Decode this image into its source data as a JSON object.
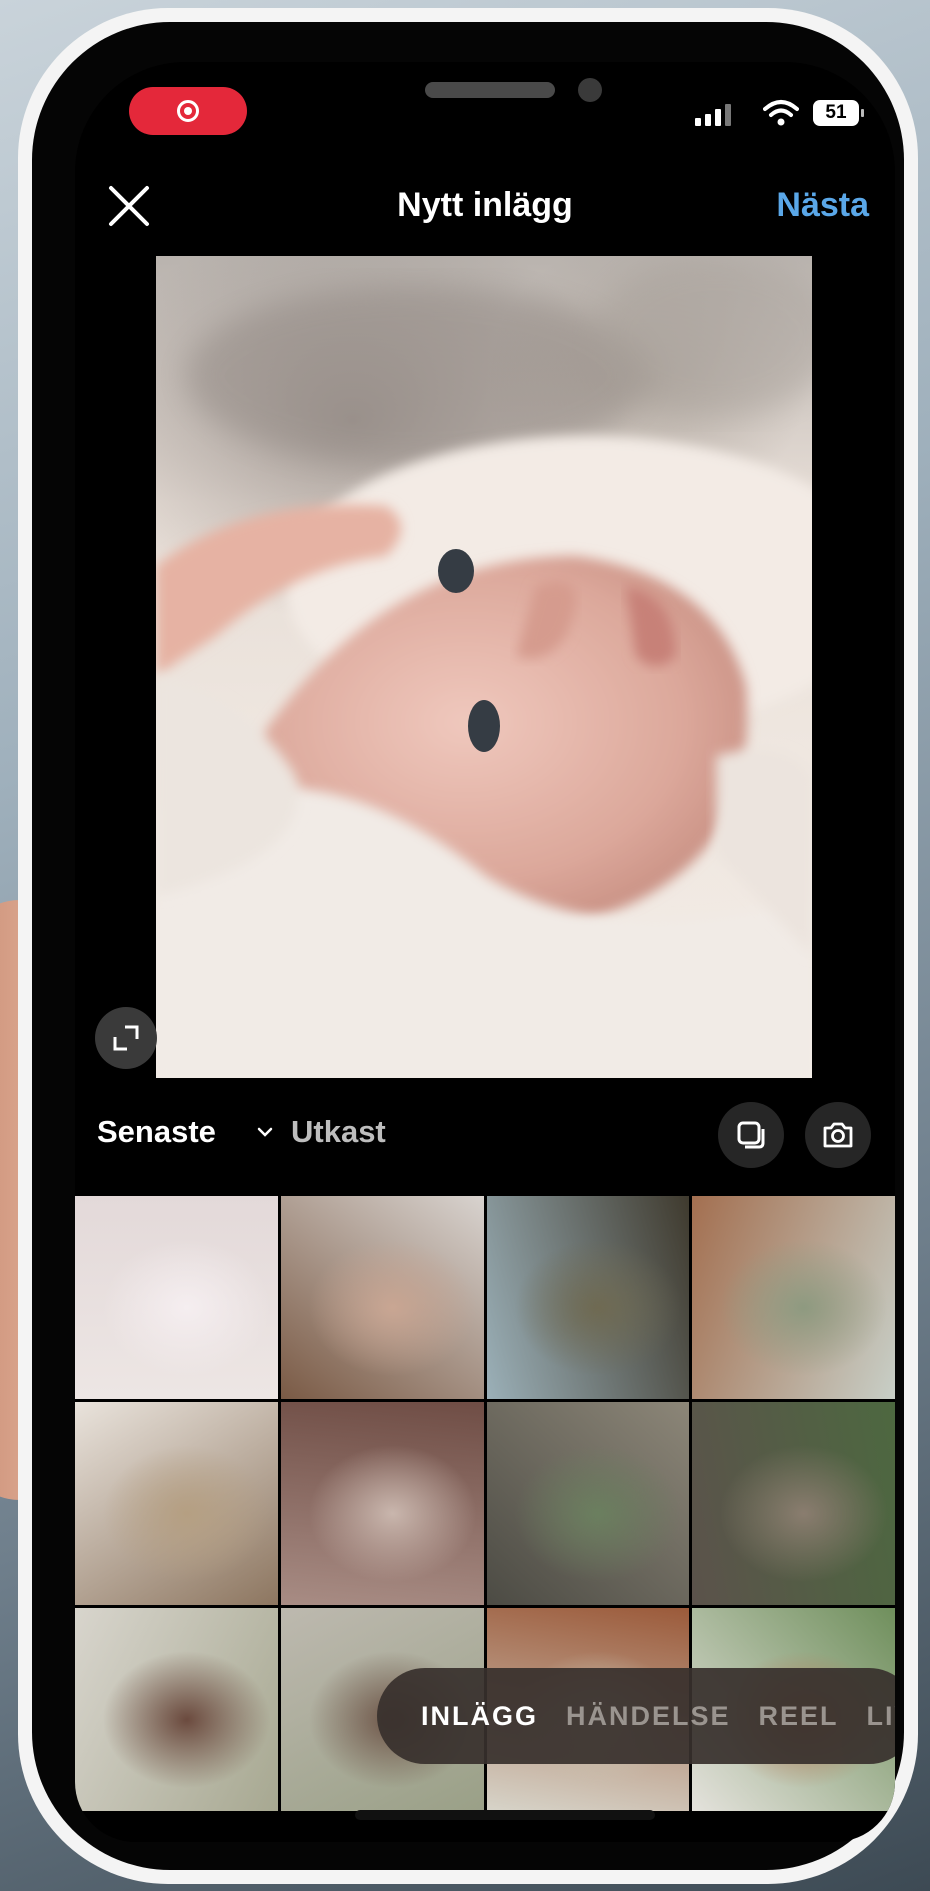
{
  "status_bar": {
    "battery": "51"
  },
  "header": {
    "title": "Nytt inlägg",
    "next_label": "Nästa"
  },
  "gallery": {
    "album_label": "Senaste",
    "drafts_label": "Utkast"
  },
  "thumbnails": [
    {
      "colors": [
        "#ede6e4",
        "#f5eef0",
        "#e3d9d9"
      ]
    },
    {
      "colors": [
        "#7a5a45",
        "#c9a693",
        "#d8d3cf"
      ]
    },
    {
      "colors": [
        "#9bb0b8",
        "#6f6a52",
        "#3f3a2e"
      ]
    },
    {
      "colors": [
        "#a36f50",
        "#8e9a80",
        "#c8cfc7"
      ]
    },
    {
      "colors": [
        "#e9e3dc",
        "#b59f82",
        "#8d7660"
      ]
    },
    {
      "colors": [
        "#a88c84",
        "#c9b6ad",
        "#6f4d45"
      ]
    },
    {
      "colors": [
        "#4c4b44",
        "#6b7f5f",
        "#8c8678"
      ]
    },
    {
      "colors": [
        "#5b524b",
        "#8a7d6f",
        "#4d6840"
      ]
    },
    {
      "colors": [
        "#d8d5cd",
        "#6b4a3e",
        "#a7a891"
      ]
    },
    {
      "colors": [
        "#bdb9af",
        "#6e5548",
        "#9aa087"
      ]
    },
    {
      "colors": [
        "#d7d4c9",
        "#c9c2b0",
        "#9b5a3a"
      ]
    },
    {
      "colors": [
        "#e4e2dc",
        "#b37a57",
        "#6f8f5c"
      ]
    }
  ],
  "modes": [
    "INLÄGG",
    "HÄNDELSE",
    "REEL",
    "LIVE"
  ],
  "colors": {
    "accent": "#5aa7e8",
    "record": "#e4283a",
    "background": "#000000"
  }
}
